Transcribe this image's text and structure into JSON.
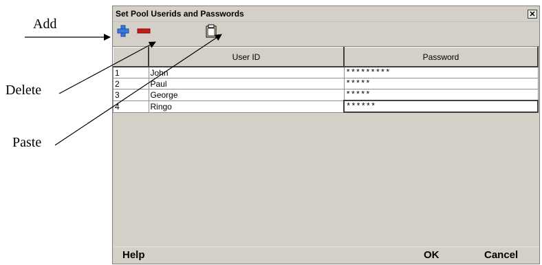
{
  "callouts": {
    "add": "Add",
    "delete": "Delete",
    "paste": "Paste"
  },
  "dialog": {
    "title": "Set Pool Userids and Passwords",
    "close_glyph": "✕",
    "toolbar": {
      "add_icon": "plus-icon",
      "delete_icon": "minus-icon",
      "paste_icon": "clipboard-icon"
    },
    "columns": [
      "",
      "User ID",
      "Password"
    ],
    "rows": [
      {
        "num": "1",
        "user": "John",
        "password": "*********"
      },
      {
        "num": "2",
        "user": "Paul",
        "password": "*****"
      },
      {
        "num": "3",
        "user": "George",
        "password": "*****"
      },
      {
        "num": "4",
        "user": "Ringo",
        "password": "******"
      }
    ],
    "buttons": {
      "help": "Help",
      "ok": "OK",
      "cancel": "Cancel"
    }
  },
  "colors": {
    "dialog_bg": "#d4d0c8",
    "add_icon": "#3a78d8",
    "delete_icon": "#c81818"
  }
}
